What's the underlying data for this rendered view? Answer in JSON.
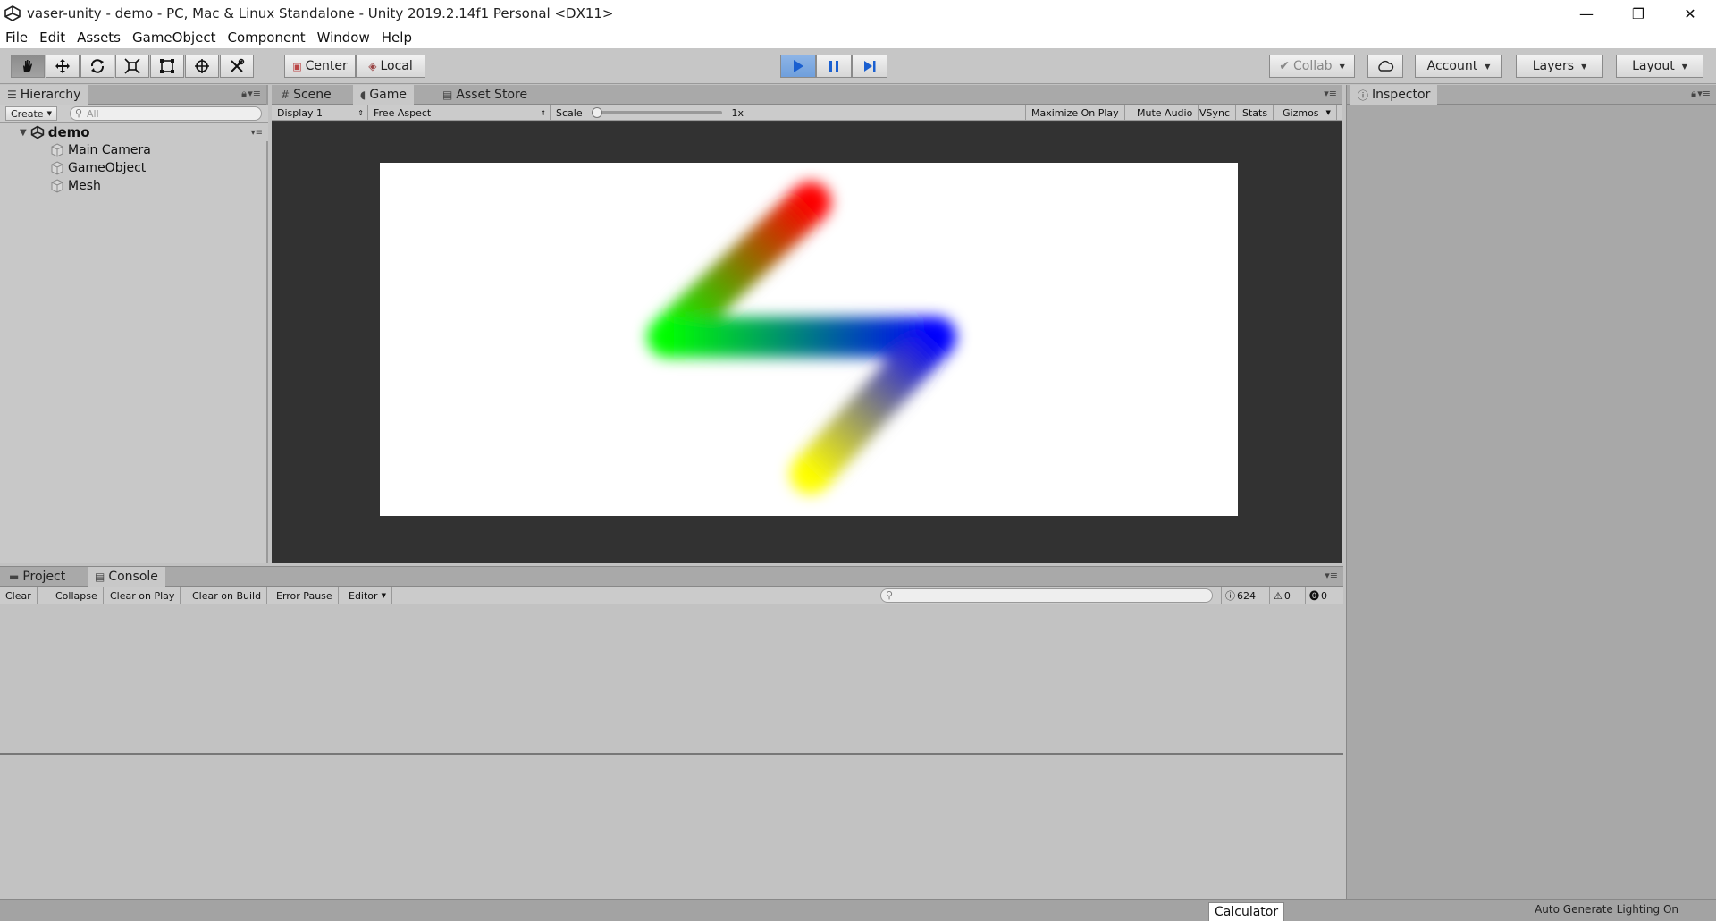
{
  "window": {
    "title": "vaser-unity - demo - PC, Mac & Linux Standalone - Unity 2019.2.14f1 Personal <DX11>",
    "controls": [
      "—",
      "❐",
      "✕"
    ]
  },
  "menu": [
    "File",
    "Edit",
    "Assets",
    "GameObject",
    "Component",
    "Window",
    "Help"
  ],
  "toolbar": {
    "tools": [
      "hand-tool-icon",
      "move-tool-icon",
      "rotate-tool-icon",
      "scale-tool-icon",
      "rect-tool-icon",
      "transform-tool-icon",
      "custom-tool-icon"
    ],
    "pivot_label": "Center",
    "space_label": "Local",
    "collab_label": "Collab",
    "account_label": "Account",
    "layers_label": "Layers",
    "layout_label": "Layout"
  },
  "hierarchy": {
    "tab": "Hierarchy",
    "create_label": "Create",
    "search_placeholder": "All",
    "scene": "demo",
    "items": [
      "Main Camera",
      "GameObject",
      "Mesh"
    ]
  },
  "center_tabs": [
    "Scene",
    "Game",
    "Asset Store"
  ],
  "game_toolbar": {
    "display": "Display 1",
    "aspect": "Free Aspect",
    "scale_label": "Scale",
    "scale_value": "1x",
    "scale_fraction": 0.0,
    "buttons": [
      "Maximize On Play",
      "Mute Audio",
      "VSync",
      "Stats",
      "Gizmos"
    ]
  },
  "inspector": {
    "tab": "Inspector"
  },
  "bottom_tabs": [
    "Project",
    "Console"
  ],
  "console": {
    "buttons": [
      "Clear",
      "Collapse",
      "Clear on Play",
      "Clear on Build",
      "Error Pause",
      "Editor"
    ],
    "log_count": "624",
    "warn_count": "0",
    "error_count": "0"
  },
  "status": {
    "tooltip": "Calculator",
    "lighting": "Auto Generate Lighting On"
  },
  "colors": {
    "play_active": "#6f9fdc",
    "stroke_start": "#ff0000",
    "stroke_mid1": "#00ff00",
    "stroke_mid2": "#0000ff",
    "stroke_end": "#ffff00"
  }
}
